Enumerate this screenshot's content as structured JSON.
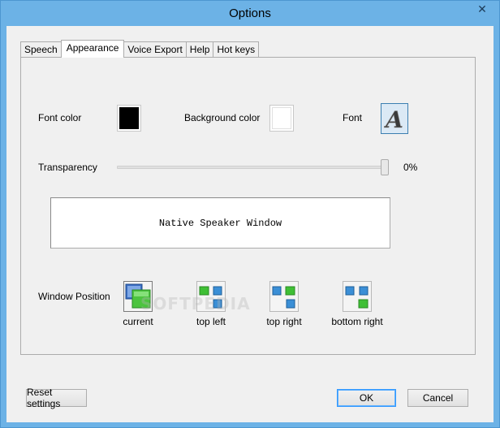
{
  "window": {
    "title": "Options"
  },
  "tabs": [
    {
      "label": "Speech"
    },
    {
      "label": "Appearance"
    },
    {
      "label": "Voice Export"
    },
    {
      "label": "Help"
    },
    {
      "label": "Hot keys"
    }
  ],
  "appearance": {
    "font_color_label": "Font color",
    "font_color": "#000000",
    "background_color_label": "Background color",
    "background_color": "#ffffff",
    "font_label": "Font",
    "transparency_label": "Transparency",
    "transparency_value": "0%",
    "transparency_level": 1.0,
    "preview_text": "Native Speaker Window",
    "window_position_label": "Window Position",
    "positions": [
      {
        "label": "current",
        "icon": "current-position-icon"
      },
      {
        "label": "top left",
        "icon": "top-left-position-icon"
      },
      {
        "label": "top right",
        "icon": "top-right-position-icon"
      },
      {
        "label": "bottom right",
        "icon": "bottom-right-position-icon"
      }
    ]
  },
  "buttons": {
    "reset": "Reset settings",
    "ok": "OK",
    "cancel": "Cancel"
  },
  "watermark": "SOFTPEDIA",
  "colors": {
    "titlebar": "#6cb2e6",
    "dialog_bg": "#f0f0f0",
    "green_tile": "#3fbf35",
    "blue_tile": "#3b8fd6"
  }
}
